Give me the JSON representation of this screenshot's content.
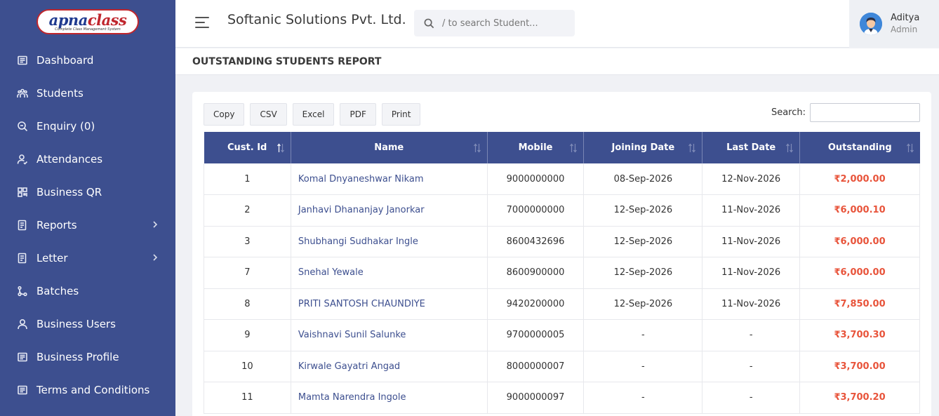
{
  "logo": {
    "main_a": "apna",
    "main_b": "class",
    "tagline": "Complete Class Management System"
  },
  "sidebar": {
    "items": [
      {
        "label": "Dashboard",
        "icon": "dashboard-icon",
        "has_arrow": false
      },
      {
        "label": "Students",
        "icon": "students-icon",
        "has_arrow": false
      },
      {
        "label": "Enquiry (0)",
        "icon": "enquiry-search-icon",
        "has_arrow": false
      },
      {
        "label": "Attendances",
        "icon": "attendance-icon",
        "has_arrow": false
      },
      {
        "label": "Business QR",
        "icon": "qr-code-icon",
        "has_arrow": false
      },
      {
        "label": "Reports",
        "icon": "reports-icon",
        "has_arrow": true
      },
      {
        "label": "Letter",
        "icon": "letter-icon",
        "has_arrow": true
      },
      {
        "label": "Batches",
        "icon": "batches-icon",
        "has_arrow": false
      },
      {
        "label": "Business Users",
        "icon": "user-icon",
        "has_arrow": false
      },
      {
        "label": "Business Profile",
        "icon": "profile-card-icon",
        "has_arrow": false
      },
      {
        "label": "Terms and Conditions",
        "icon": "terms-icon",
        "has_arrow": false
      }
    ]
  },
  "header": {
    "company": "Softanic Solutions Pvt. Ltd.",
    "search_placeholder": "/ to search Student...",
    "user": {
      "name": "Aditya",
      "role": "Admin"
    }
  },
  "page": {
    "title": "OUTSTANDING STUDENTS REPORT"
  },
  "toolbar": {
    "buttons": [
      "Copy",
      "CSV",
      "Excel",
      "PDF",
      "Print"
    ],
    "search_label": "Search:"
  },
  "table": {
    "columns": [
      "Cust. Id",
      "Name",
      "Mobile",
      "Joining Date",
      "Last Date",
      "Outstanding"
    ],
    "sorted_column": "Cust. Id",
    "rows": [
      {
        "id": "1",
        "name": "Komal Dnyaneshwar Nikam",
        "mobile": "9000000000",
        "joining": "08-Sep-2026",
        "last": "12-Nov-2026",
        "outstanding": "₹2,000.00"
      },
      {
        "id": "2",
        "name": "Janhavi Dhananjay Janorkar",
        "mobile": "7000000000",
        "joining": "12-Sep-2026",
        "last": "11-Nov-2026",
        "outstanding": "₹6,000.10"
      },
      {
        "id": "3",
        "name": "Shubhangi Sudhakar Ingle",
        "mobile": "8600432696",
        "joining": "12-Sep-2026",
        "last": "11-Nov-2026",
        "outstanding": "₹6,000.00"
      },
      {
        "id": "7",
        "name": "Snehal Yewale",
        "mobile": "8600900000",
        "joining": "12-Sep-2026",
        "last": "11-Nov-2026",
        "outstanding": "₹6,000.00"
      },
      {
        "id": "8",
        "name": "PRITI SANTOSH CHAUNDIYE",
        "mobile": "9420200000",
        "joining": "12-Sep-2026",
        "last": "11-Nov-2026",
        "outstanding": "₹7,850.00"
      },
      {
        "id": "9",
        "name": "Vaishnavi Sunil Salunke",
        "mobile": "9700000005",
        "joining": "-",
        "last": "-",
        "outstanding": "₹3,700.30"
      },
      {
        "id": "10",
        "name": "Kirwale Gayatri Angad",
        "mobile": "8000000007",
        "joining": "-",
        "last": "-",
        "outstanding": "₹3,700.00"
      },
      {
        "id": "11",
        "name": "Mamta Narendra Ingole",
        "mobile": "9000000097",
        "joining": "-",
        "last": "-",
        "outstanding": "₹3,700.20"
      }
    ]
  },
  "colors": {
    "sidebar_bg": "#3d4f8f",
    "header_bg": "#3d4f8f",
    "amount": "#e8543b",
    "link": "#3d4f8f"
  }
}
